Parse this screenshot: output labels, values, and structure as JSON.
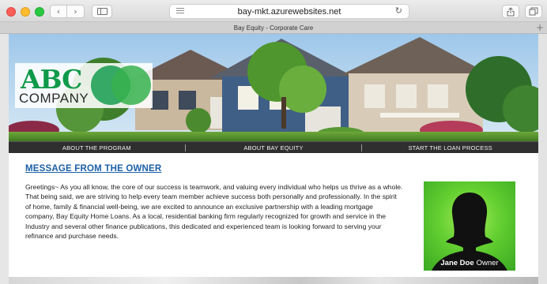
{
  "browser": {
    "url": "bay-mkt.azurewebsites.net",
    "tab_title": "Bay Equity - Corporate Care",
    "icons": {
      "back": "chevron-left-icon",
      "forward": "chevron-right-icon",
      "sidebar": "sidebar-icon",
      "reader": "reader-icon",
      "reload": "reload-icon",
      "share": "share-icon",
      "tabs": "tabs-icon",
      "new_tab": "plus-icon"
    }
  },
  "logo": {
    "letters": "ABC",
    "company": "COMPANY",
    "color": "#0f9a49"
  },
  "nav": {
    "items": [
      {
        "label": "ABOUT THE PROGRAM"
      },
      {
        "label": "ABOUT BAY EQUITY"
      },
      {
        "label": "START THE LOAN PROCESS"
      }
    ]
  },
  "message": {
    "title": "MESSAGE FROM THE OWNER",
    "body": "Greetings~ As you all know, the core of our success is teamwork, and valuing every individual who helps us thrive as a whole. That being said, we are striving to help every team member achieve success both personally and professionally. In the spirit of home, family & financial well-being, we are excited to announce an exclusive partnership with a leading mortgage company, Bay Equity Home Loans. As a local, residential banking firm regularly recognized for growth and service in the Industry and several other finance publications, this dedicated and experienced team is looking forward to serving your refinance and purchase needs."
  },
  "owner": {
    "name": "Jane Doe",
    "role": "Owner"
  },
  "colors": {
    "link": "#1b5fa8",
    "nav_background": "#2f2f2f",
    "photo_green": "#63cf31"
  }
}
